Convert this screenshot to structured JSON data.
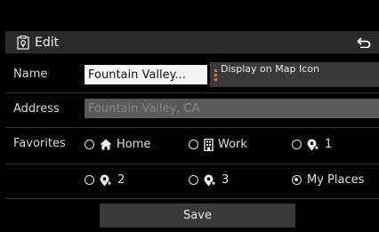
{
  "header": {
    "title": "Edit",
    "title_icon": "edit-location-icon",
    "back_icon": "back-arrow-icon"
  },
  "name": {
    "label": "Name",
    "value": "Fountain Valley...",
    "map_icon_button": "Display on Map Icon"
  },
  "address": {
    "label": "Address",
    "value": "Fountain Valley, CA"
  },
  "favorites": {
    "label": "Favorites",
    "options": [
      {
        "label": "Home",
        "icon": "home-icon",
        "selected": false
      },
      {
        "label": "Work",
        "icon": "building-icon",
        "selected": false
      },
      {
        "label": "1",
        "icon": "star-pin-icon",
        "selected": false
      },
      {
        "label": "2",
        "icon": "star-pin-icon",
        "selected": false
      },
      {
        "label": "3",
        "icon": "star-pin-icon",
        "selected": false
      },
      {
        "label": "My Places",
        "icon": "",
        "selected": true
      }
    ]
  },
  "footer": {
    "save_label": "Save"
  },
  "colors": {
    "accent_dots": "#e07b1a",
    "input_bg": "#f4f4f4",
    "disabled_input_bg": "#5a5a5a"
  }
}
